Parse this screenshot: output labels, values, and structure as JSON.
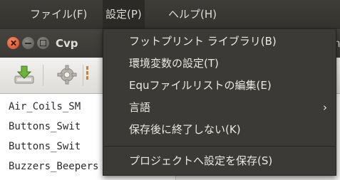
{
  "menubar": {
    "items": [
      "ファイル(F)",
      "設定(P)",
      "ヘルプ(H)"
    ]
  },
  "window": {
    "title": "Cvp",
    "title_right": "h"
  },
  "toolbar": {
    "icons": [
      "download-icon",
      "gear-icon"
    ]
  },
  "list": {
    "items": [
      "Air_Coils_SM",
      "Buttons_Swit",
      "Buttons_Swit",
      "Buzzers_Beepers"
    ]
  },
  "dropdown": {
    "items": [
      "フットプリント ライブラリ(B)",
      "環境変数の設定(T)",
      "Equファイルリストの編集(E)",
      "言語",
      "保存後に終了しない(K)",
      "プロジェクトへ設定を保存(S)"
    ],
    "submenu_arrow": "›"
  },
  "colors": {
    "menu_bg": "#3b3a36",
    "menu_text": "#ebe8e1",
    "close_button": "#e0592a",
    "toolbar_separator": "#e07b23"
  }
}
